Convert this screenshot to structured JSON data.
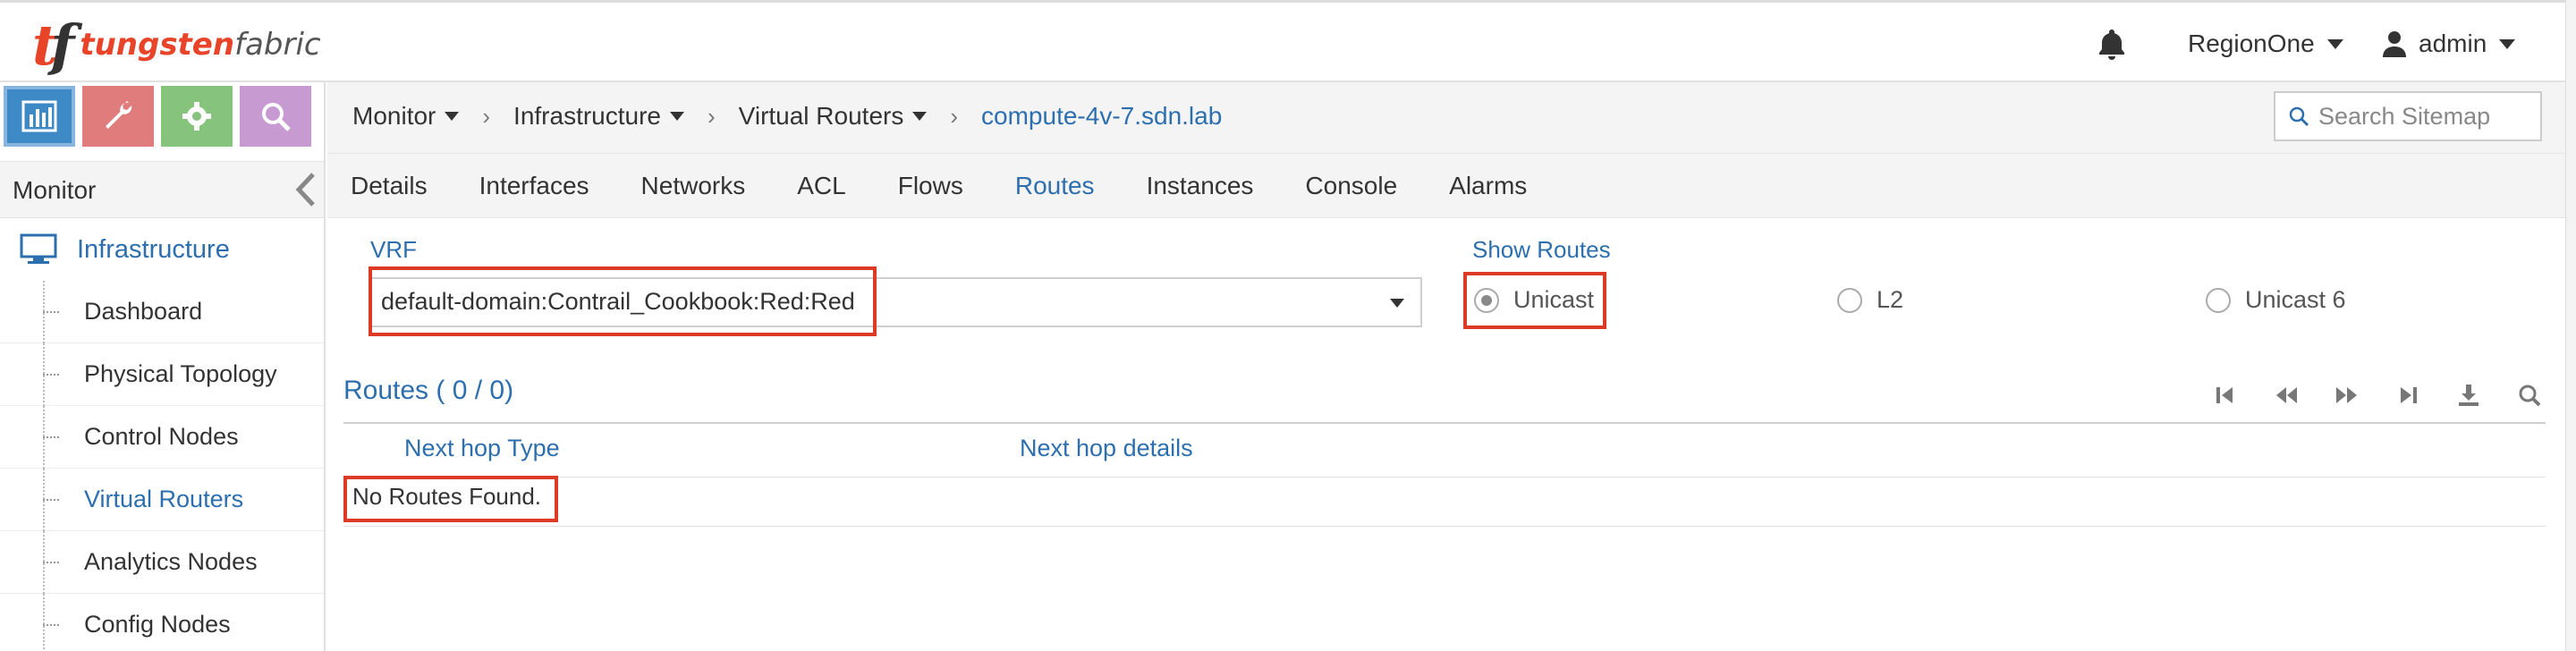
{
  "header": {
    "logo_mark": "tf",
    "logo_brand_bold": "tungsten",
    "logo_brand_light": "fabric",
    "region": "RegionOne",
    "user": "admin"
  },
  "sidebar": {
    "section_title": "Monitor",
    "group_label": "Infrastructure",
    "items": [
      {
        "label": "Dashboard",
        "active": false
      },
      {
        "label": "Physical Topology",
        "active": false
      },
      {
        "label": "Control Nodes",
        "active": false
      },
      {
        "label": "Virtual Routers",
        "active": true
      },
      {
        "label": "Analytics Nodes",
        "active": false
      },
      {
        "label": "Config Nodes",
        "active": false
      }
    ]
  },
  "breadcrumb": {
    "items": [
      "Monitor",
      "Infrastructure",
      "Virtual Routers"
    ],
    "current": "compute-4v-7.sdn.lab"
  },
  "search": {
    "placeholder": "Search Sitemap"
  },
  "tabs": [
    "Details",
    "Interfaces",
    "Networks",
    "ACL",
    "Flows",
    "Routes",
    "Instances",
    "Console",
    "Alarms"
  ],
  "active_tab": "Routes",
  "vrf": {
    "label": "VRF",
    "value": "default-domain:Contrail_Cookbook:Red:Red"
  },
  "show_routes": {
    "label": "Show Routes",
    "options": [
      {
        "label": "Unicast",
        "checked": true
      },
      {
        "label": "L2",
        "checked": false
      },
      {
        "label": "Unicast 6",
        "checked": false
      }
    ]
  },
  "routes_grid": {
    "title": "Routes ( 0 / 0)",
    "columns": [
      "Next hop Type",
      "Next hop details"
    ],
    "empty_message": "No Routes Found."
  },
  "colors": {
    "accent": "#2d6fae",
    "highlight": "#dd3b26",
    "brand_red": "#e8442a"
  }
}
